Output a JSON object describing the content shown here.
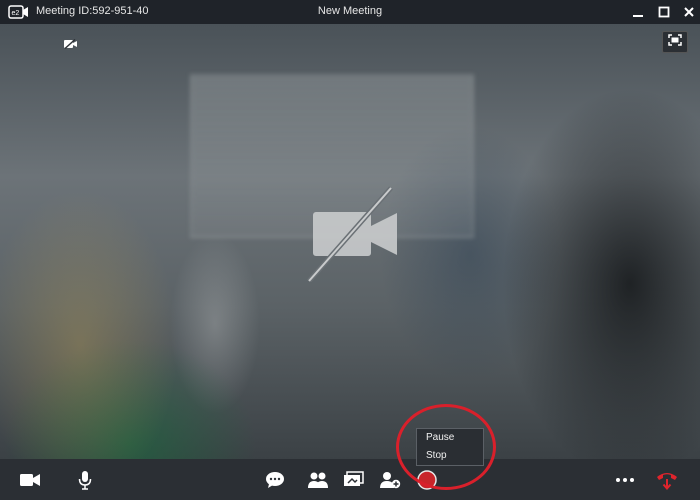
{
  "titlebar": {
    "meeting_id": "Meeting ID:592-951-40",
    "title": "New Meeting",
    "icons": [
      "app-logo-icon",
      "minimize-icon",
      "maximize-icon",
      "close-icon"
    ]
  },
  "video": {
    "icons": [
      "camera-off-small-icon",
      "fullscreen-icon",
      "camera-off-icon"
    ]
  },
  "record_menu": {
    "items": [
      {
        "label": "Pause"
      },
      {
        "label": "Stop"
      }
    ]
  },
  "toolbar": {
    "icons": [
      "video-camera-icon",
      "microphone-icon",
      "chat-icon",
      "participants-icon",
      "share-screen-icon",
      "invite-user-icon",
      "record-icon",
      "more-icon",
      "hang-up-icon"
    ]
  },
  "colors": {
    "titlebar_bg": "#1f2329",
    "toolbar_bg": "#2b2f34",
    "record_red": "#c8252a",
    "hangup_red": "#e0242c",
    "highlight_red": "#d9202b"
  }
}
